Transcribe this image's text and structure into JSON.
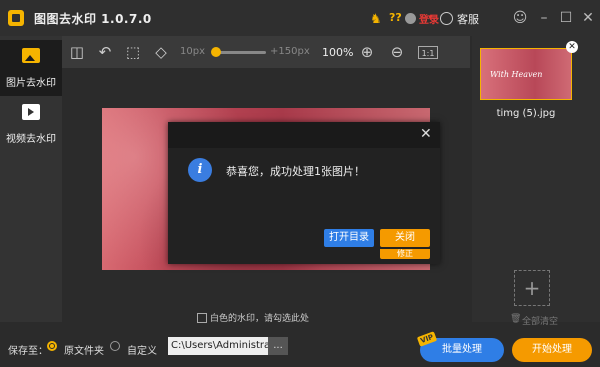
{
  "titlebar": {
    "app_title": "图图去水印  1.0.7.0",
    "help": "??",
    "user_name": "登录",
    "service_label": "客服",
    "icons": {
      "qq": "qq-icon",
      "skin": "skin-icon",
      "minimize": "minimize-icon",
      "maximize": "maximize-icon",
      "close": "close-icon"
    }
  },
  "sidebar": {
    "items": [
      {
        "label": "图片去水印",
        "icon": "image-icon",
        "active": true
      },
      {
        "label": "视频去水印",
        "icon": "video-icon",
        "active": false
      }
    ]
  },
  "toolbar": {
    "brush_min": "10px",
    "brush_max": "+150px",
    "brush_level": 0.0,
    "zoom": "100%",
    "zoom_fit": "1:1",
    "icons": [
      "split-view-icon",
      "undo-icon",
      "crop-icon",
      "eraser-icon",
      "zoom-in-icon",
      "zoom-out-icon"
    ]
  },
  "dialog": {
    "message": "恭喜您，成功处理1张图片！",
    "open_dir_label": "打开目录",
    "close_label": "关闭",
    "modify_label": "修正"
  },
  "options": {
    "colored_watermark_label": "白色的水印，请勾选此处",
    "colored_watermark_checked": false
  },
  "right_panel": {
    "thumbnail": {
      "file_name": "timg (5).jpg",
      "overlay_text": "With Heaven"
    },
    "add_label": "+",
    "clear_all_label": "全部清空"
  },
  "bottombar": {
    "save_to_label": "保存至：",
    "radio_original_label": "原文件夹",
    "radio_custom_label": "自定义",
    "selected": "原文件夹",
    "path_value": "C:\\Users\\Administrator",
    "browse_label": "...",
    "batch_label": "批量处理",
    "vip_badge": "VIP",
    "start_label": "开始处理"
  },
  "colors": {
    "accent": "#f5b400",
    "primary_blue": "#2f7ee6",
    "orange": "#f59a00",
    "bg": "#2b2b2b"
  }
}
